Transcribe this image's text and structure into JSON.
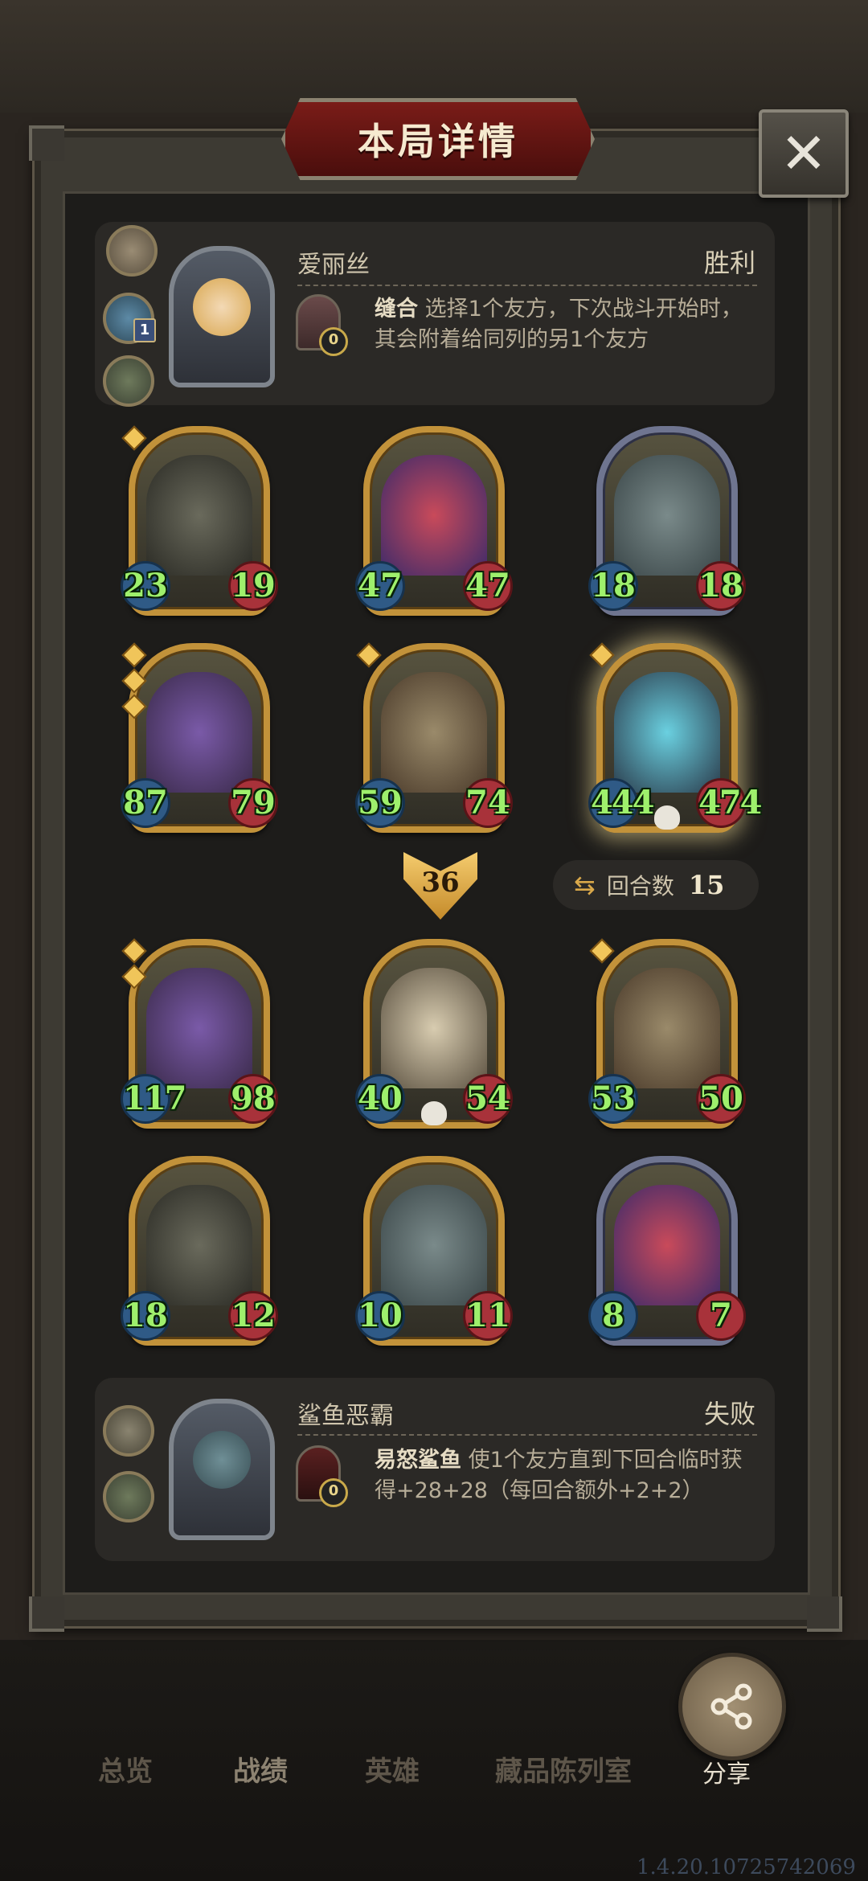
{
  "dialog": {
    "title": "本局详情",
    "close_icon": "close-icon"
  },
  "colors": {
    "attack": "#2f5a86",
    "health": "#a8323a",
    "stat_text": "#9ef06c",
    "gold_frame": "#c2923a",
    "title_red": "#7a1c18"
  },
  "player_top": {
    "name": "爱丽丝",
    "result": "胜利",
    "side_icons": [
      "pocket-watch-icon",
      "fish-icon",
      "relic-icon"
    ],
    "side_badge": "1",
    "skill_count": "0",
    "skill_name": "缝合",
    "skill_text": "选择1个友方，下次战斗开始时，其会附着给同列的另1个友方"
  },
  "board_top": [
    {
      "atk": "23",
      "hp": "19",
      "stars": 1,
      "frame": "gold",
      "art": "reaper"
    },
    {
      "atk": "47",
      "hp": "47",
      "stars": 0,
      "frame": "gold",
      "art": "clown"
    },
    {
      "atk": "18",
      "hp": "18",
      "stars": 0,
      "frame": "silver",
      "art": "beast"
    },
    {
      "atk": "87",
      "hp": "79",
      "stars": 3,
      "frame": "gold",
      "art": "dragon"
    },
    {
      "atk": "59",
      "hp": "74",
      "stars": 1,
      "frame": "gold",
      "art": "airship"
    },
    {
      "atk": "444",
      "hp": "474",
      "stars": 1,
      "frame": "gold",
      "art": "demon",
      "glow": true,
      "skull": true
    }
  ],
  "round": {
    "number": "36",
    "turns_label": "回合数",
    "turns_value": "15"
  },
  "board_bottom": [
    {
      "atk": "117",
      "hp": "98",
      "stars": 2,
      "frame": "gold",
      "art": "dragon"
    },
    {
      "atk": "40",
      "hp": "54",
      "stars": 0,
      "frame": "gold",
      "art": "skeleton",
      "skull": true
    },
    {
      "atk": "53",
      "hp": "50",
      "stars": 1,
      "frame": "gold",
      "art": "airship"
    },
    {
      "atk": "18",
      "hp": "12",
      "stars": 0,
      "frame": "gold",
      "art": "reaper"
    },
    {
      "atk": "10",
      "hp": "11",
      "stars": 0,
      "frame": "gold",
      "art": "beast"
    },
    {
      "atk": "8",
      "hp": "7",
      "stars": 0,
      "frame": "silver",
      "art": "clown"
    }
  ],
  "player_bottom": {
    "name": "鲨鱼恶霸",
    "result": "失败",
    "side_icons": [
      "relic-icon",
      "relic-icon"
    ],
    "skill_count": "0",
    "skill_name": "易怒鲨鱼",
    "skill_text": "使1个友方直到下回合临时获得+28+28（每回合额外+2+2）"
  },
  "tabs": [
    "总览",
    "战绩",
    "英雄",
    "藏品陈列室"
  ],
  "share": {
    "label": "分享"
  },
  "version": "1.4.20.10725742069"
}
